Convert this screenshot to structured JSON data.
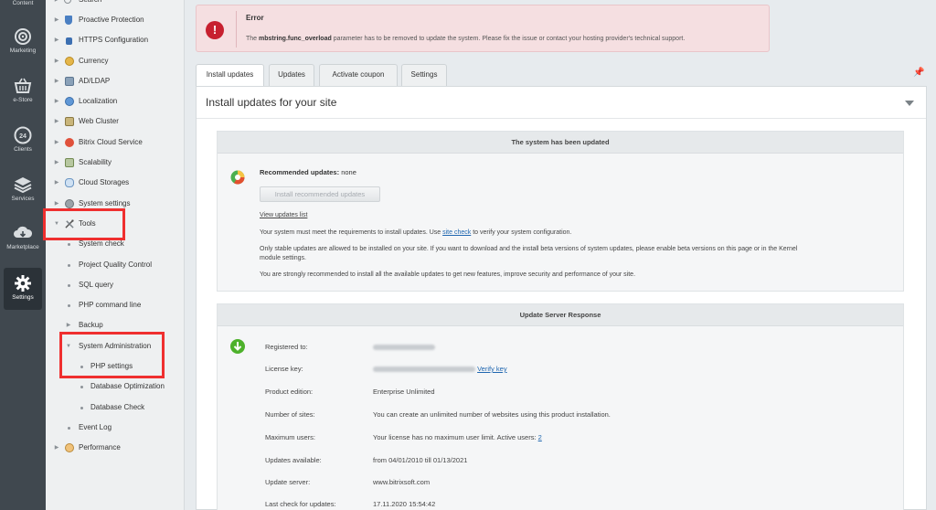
{
  "iconbar": {
    "items": [
      {
        "label": "Content",
        "icon": "content-icon"
      },
      {
        "label": "Marketing",
        "icon": "target-icon"
      },
      {
        "label": "e-Store",
        "icon": "basket-icon"
      },
      {
        "label": "Clients",
        "icon": "clock-24-icon"
      },
      {
        "label": "Services",
        "icon": "layers-icon"
      },
      {
        "label": "Marketplace",
        "icon": "cloud-download-icon"
      },
      {
        "label": "Settings",
        "icon": "gear-icon"
      }
    ]
  },
  "menu": {
    "items": [
      {
        "label": "Search",
        "type": "collapsed"
      },
      {
        "label": "Proactive Protection",
        "type": "collapsed"
      },
      {
        "label": "HTTPS Configuration",
        "type": "collapsed"
      },
      {
        "label": "Currency",
        "type": "collapsed"
      },
      {
        "label": "AD/LDAP",
        "type": "collapsed"
      },
      {
        "label": "Localization",
        "type": "collapsed"
      },
      {
        "label": "Web Cluster",
        "type": "collapsed"
      },
      {
        "label": "Bitrix Cloud Service",
        "type": "collapsed"
      },
      {
        "label": "Scalability",
        "type": "collapsed"
      },
      {
        "label": "Cloud Storages",
        "type": "collapsed"
      },
      {
        "label": "System settings",
        "type": "collapsed"
      },
      {
        "label": "Tools",
        "type": "expanded"
      },
      {
        "label": "System check",
        "type": "sub"
      },
      {
        "label": "Project Quality Control",
        "type": "sub"
      },
      {
        "label": "SQL query",
        "type": "sub"
      },
      {
        "label": "PHP command line",
        "type": "sub"
      },
      {
        "label": "Backup",
        "type": "subcollapsed"
      },
      {
        "label": "System Administration",
        "type": "subexpanded"
      },
      {
        "label": "PHP settings",
        "type": "subsub"
      },
      {
        "label": "Database Optimization",
        "type": "subsub"
      },
      {
        "label": "Database Check",
        "type": "subsub"
      },
      {
        "label": "Event Log",
        "type": "sub"
      },
      {
        "label": "Performance",
        "type": "collapsed"
      }
    ]
  },
  "error": {
    "title": "Error",
    "message_pre": "The ",
    "message_bold": "mbstring.func_overload",
    "message_post": " parameter has to be removed to update the system. Please fix the issue or contact your hosting provider's technical support."
  },
  "tabs": [
    "Install updates",
    "Updates",
    "Activate coupon",
    "Settings"
  ],
  "panel": {
    "title": "Install updates for your site",
    "box1": {
      "header": "The system has been updated",
      "rec_label": "Recommended updates:",
      "rec_value": " none",
      "install_button": "Install recommended updates",
      "view_link": "View updates list",
      "req_pre": "Your system must meet the requirements to install updates. Use ",
      "req_link": "site check",
      "req_post": " to verify your system configuration.",
      "stable_line1": "Only stable updates are allowed to be installed on your site. If you want to download and the install beta versions of system updates, please enable beta versions on this page or in the Kernel",
      "stable_line2": "module settings.",
      "recommend": "You are strongly recommended to install all the available updates to get new features, improve security and performance of your site."
    },
    "box2": {
      "header": "Update Server Response",
      "rows": [
        {
          "key": "Registered to:",
          "value": ""
        },
        {
          "key": "License key:",
          "value": "",
          "link": "Verify key"
        },
        {
          "key": "Product edition:",
          "value": "Enterprise Unlimited"
        },
        {
          "key": "Number of sites:",
          "value": "You can create an unlimited number of websites using this product installation."
        },
        {
          "key": "Maximum users:",
          "value": "Your license has no maximum user limit. Active users: ",
          "link": "2"
        },
        {
          "key": "Updates available:",
          "value": "from 04/01/2010 till 01/13/2021"
        },
        {
          "key": "Update server:",
          "value": "www.bitrixsoft.com"
        },
        {
          "key": "Last check for updates:",
          "value": "17.11.2020 15:54:42"
        }
      ]
    }
  },
  "colors": {
    "error_bg": "#f5dfe1",
    "error_icon": "#c7202f",
    "highlight": "#ef2f2f",
    "link": "#2067b0"
  }
}
